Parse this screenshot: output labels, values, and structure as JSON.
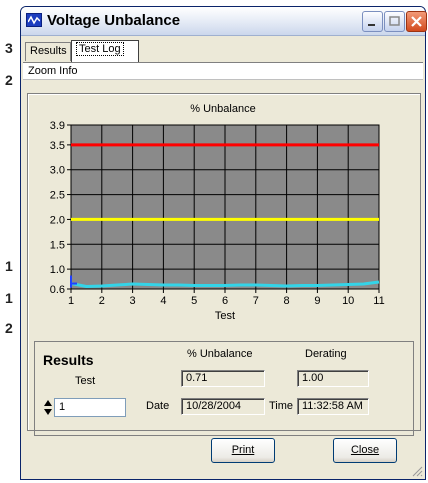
{
  "background": {
    "fragments": [
      "3",
      "2",
      "1",
      "1",
      "2"
    ]
  },
  "window": {
    "title": "Voltage Unbalance",
    "tabs": [
      "Results",
      "Test Log"
    ],
    "active_tab": "Test Log",
    "menu": [
      "Zoom Info"
    ]
  },
  "colors": {
    "plot_bg": "#8a8a8a",
    "limit_high": "#ff0000",
    "limit_mid": "#ffff00",
    "series": "#33d4e8"
  },
  "chart_data": {
    "type": "line",
    "title": "% Unbalance",
    "xlabel": "Test",
    "ylabel": "",
    "xlim": [
      1,
      11
    ],
    "ylim": [
      0.6,
      3.9
    ],
    "x_ticks": [
      "1",
      "2",
      "3",
      "4",
      "5",
      "6",
      "7",
      "8",
      "9",
      "10",
      "11"
    ],
    "y_ticks": [
      {
        "v": 0.6,
        "label": "0.6"
      },
      {
        "v": 1.0,
        "label": "1.0"
      },
      {
        "v": 1.5,
        "label": "1.5"
      },
      {
        "v": 2.0,
        "label": "2.0"
      },
      {
        "v": 2.5,
        "label": "2.5"
      },
      {
        "v": 3.0,
        "label": "3.0"
      },
      {
        "v": 3.5,
        "label": "3.5"
      },
      {
        "v": 3.9,
        "label": "3.9"
      }
    ],
    "grid": true,
    "limit_lines": [
      {
        "value": 3.5,
        "color": "#ff0000"
      },
      {
        "value": 2.0,
        "color": "#ffff00"
      }
    ],
    "series": [
      {
        "color": "#33d4e8",
        "x": [
          1,
          1.5,
          2,
          2.5,
          3,
          3.5,
          4,
          4.5,
          5,
          5.5,
          6,
          6.5,
          7,
          7.5,
          8,
          8.5,
          9,
          9.5,
          10,
          10.5,
          11
        ],
        "values": [
          0.71,
          0.65,
          0.66,
          0.68,
          0.7,
          0.69,
          0.68,
          0.68,
          0.67,
          0.67,
          0.67,
          0.68,
          0.68,
          0.67,
          0.66,
          0.67,
          0.67,
          0.68,
          0.69,
          0.7,
          0.74
        ]
      }
    ]
  },
  "results": {
    "heading": "Results",
    "test_label": "Test",
    "test_value": "1",
    "unbalance_label": "% Unbalance",
    "unbalance_value": "0.71",
    "derating_label": "Derating",
    "derating_value": "1.00",
    "date_label": "Date",
    "date_value": "10/28/2004",
    "time_label": "Time",
    "time_value": "11:32:58 AM"
  },
  "buttons": {
    "print": "Print",
    "close": "Close"
  }
}
